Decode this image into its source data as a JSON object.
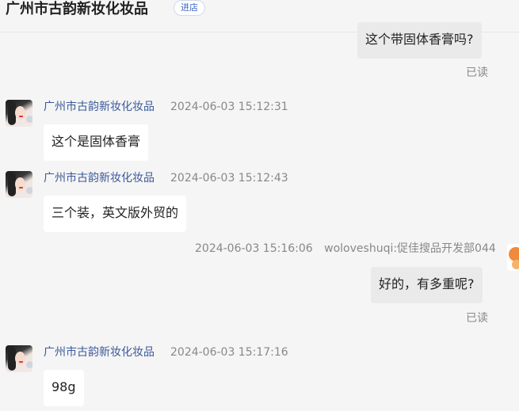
{
  "header": {
    "shop_name": "广州市古韵新妆化妆品",
    "enter_store": "进店"
  },
  "messages": [
    {
      "side": "right",
      "text": "这个带固体香膏吗?",
      "status": "已读"
    },
    {
      "side": "left",
      "sender": "广州市古韵新妆化妆品",
      "time": "2024-06-03 15:12:31",
      "text": "这个是固体香膏"
    },
    {
      "side": "left",
      "sender": "广州市古韵新妆化妆品",
      "time": "2024-06-03 15:12:43",
      "text": "三个装，英文版外贸的"
    },
    {
      "side": "right",
      "time": "2024-06-03 15:16:06",
      "sender": "woloveshuqi:促佳搜品开发部044",
      "text": "好的，有多重呢?",
      "status": "已读"
    },
    {
      "side": "left",
      "sender": "广州市古韵新妆化妆品",
      "time": "2024-06-03 15:17:16",
      "text": "98g"
    }
  ]
}
